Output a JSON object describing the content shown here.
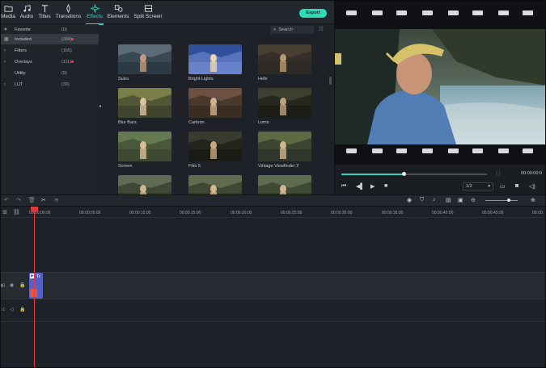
{
  "toolbar": {
    "tabs": [
      {
        "label": "Media",
        "icon": "folder-icon"
      },
      {
        "label": "Audio",
        "icon": "music-note-icon"
      },
      {
        "label": "Titles",
        "icon": "text-icon"
      },
      {
        "label": "Transitions",
        "icon": "transition-icon"
      },
      {
        "label": "Effects",
        "icon": "sparkle-icon",
        "active": true
      },
      {
        "label": "Elements",
        "icon": "shapes-icon"
      },
      {
        "label": "Split Screen",
        "icon": "split-screen-icon"
      }
    ],
    "export_label": "Export"
  },
  "sidebar": {
    "items": [
      {
        "label": "Favorite",
        "count": "(0)",
        "icon": "heart-icon"
      },
      {
        "label": "Included",
        "count": "(368)",
        "icon": "grid-icon",
        "selected": true,
        "dot": true
      },
      {
        "label": "Filters",
        "count": "(165)",
        "icon": "chevron-right-icon"
      },
      {
        "label": "Overlays",
        "count": "(111)",
        "icon": "chevron-right-icon",
        "dot": true
      },
      {
        "label": "Utility",
        "count": "(9)",
        "icon": ""
      },
      {
        "label": "LUT",
        "count": "(39)",
        "icon": "chevron-right-icon"
      }
    ]
  },
  "effects": {
    "search_placeholder": "Search",
    "items": [
      {
        "label": "Sutro"
      },
      {
        "label": "Bright Lights"
      },
      {
        "label": "Hefe"
      },
      {
        "label": "Blur Bars"
      },
      {
        "label": "Cartoon"
      },
      {
        "label": "Lomo"
      },
      {
        "label": "Screen"
      },
      {
        "label": "Film 5"
      },
      {
        "label": "Vintage Viewfinder 2"
      },
      {
        "label": ""
      },
      {
        "label": ""
      },
      {
        "label": ""
      }
    ]
  },
  "preview": {
    "timecode": "00:00:00:0",
    "quality": "1/2",
    "progress": 0.43
  },
  "timeline": {
    "ruler": [
      "00:00:00:00",
      "00:00:05:00",
      "00:00:10:00",
      "00:00:15:00",
      "00:00:20:00",
      "00:00:25:00",
      "00:00:30:00",
      "00:00:35:00",
      "00:00:40:00",
      "00:00:45:00",
      "00:00:"
    ],
    "video_track_label": "1",
    "audio_track_label": "1",
    "clip_label": "Tr"
  },
  "colors": {
    "accent": "#2fd3c1",
    "export": "#2ddbb6",
    "playhead": "#e33b3b",
    "clip": "#5560c8"
  }
}
